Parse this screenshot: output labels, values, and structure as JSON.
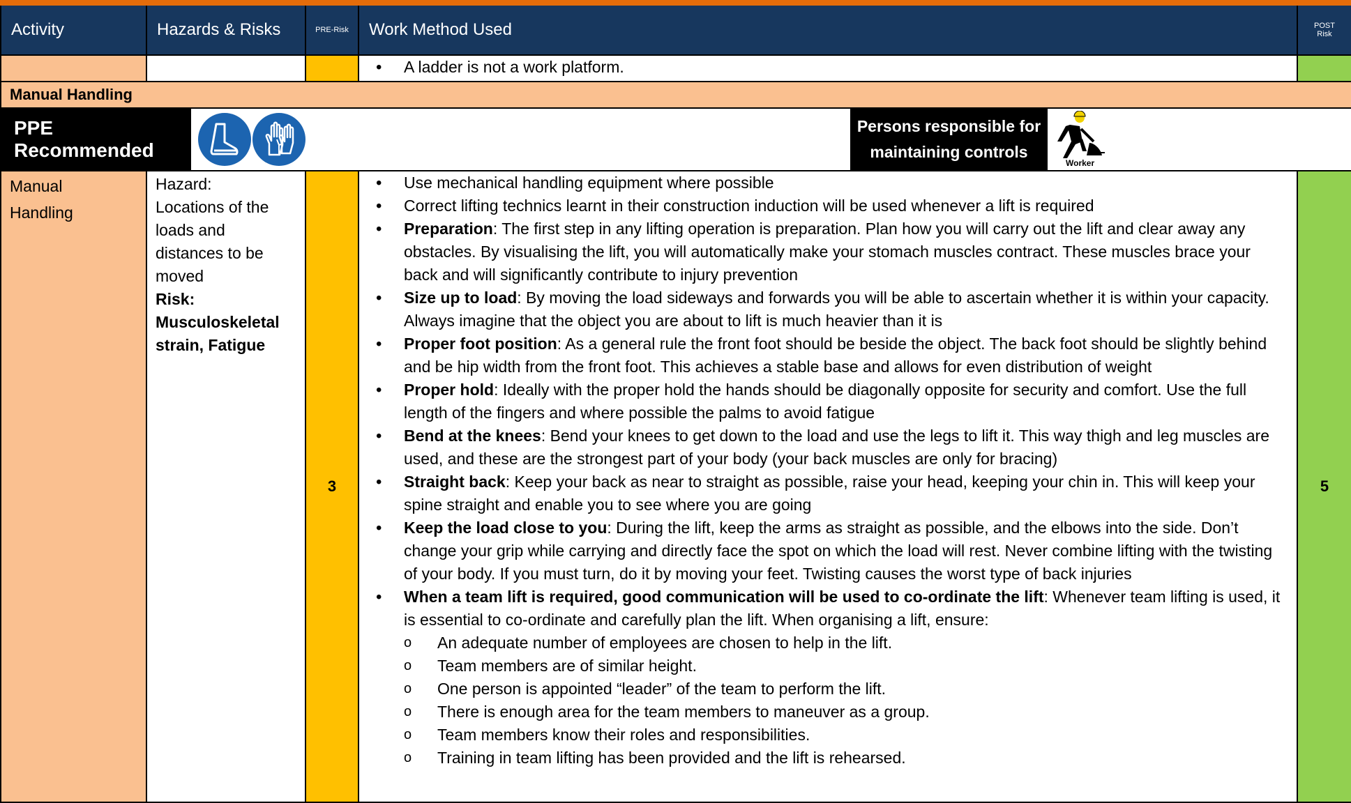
{
  "header": {
    "activity": "Activity",
    "hazards": "Hazards & Risks",
    "pre_risk": "PRE-Risk",
    "work_method": "Work Method Used",
    "post_risk_line1": "POST",
    "post_risk_line2": "Risk"
  },
  "continuation": {
    "bullet": "A ladder is not a work platform."
  },
  "section": {
    "title": "Manual Handling"
  },
  "ppe": {
    "label": "PPE Recommended",
    "icons": [
      "safety-boots-icon",
      "safety-gloves-icon"
    ],
    "persons_line1": "Persons responsible for",
    "persons_line2": "maintaining controls",
    "worker_label": "Worker",
    "icon_color": "#1c64b0"
  },
  "row": {
    "activity_line1": "Manual",
    "activity_line2": "Handling",
    "hazard_label": "Hazard:",
    "hazard_lines": [
      "Locations of the",
      "loads and",
      "distances to be",
      "moved"
    ],
    "risk_lines": [
      "Risk:",
      "Musculoskeletal",
      "strain, Fatigue"
    ],
    "pre_risk": "3",
    "post_risk": "5",
    "methods": [
      {
        "bold": "",
        "text": "Use mechanical handling equipment where possible"
      },
      {
        "bold": "",
        "text": "Correct lifting technics learnt in their construction induction will be used whenever a lift is required"
      },
      {
        "bold": "Preparation",
        "text": ":  The first step in any lifting operation is preparation. Plan how you will carry out the lift and clear away any obstacles. By visualising the lift, you will automatically make your stomach muscles contract. These muscles brace your back and will significantly contribute to injury prevention"
      },
      {
        "bold": "Size up to load",
        "text": ":  By moving the load sideways and forwards you will be able to ascertain whether it is within your capacity. Always imagine that the object you are about to lift is much heavier than it is"
      },
      {
        "bold": "Proper foot position",
        "text": ":  As a general rule the front foot should be beside the object. The back foot should be slightly behind and be hip width from the front foot. This achieves a stable base and allows for even distribution of weight"
      },
      {
        "bold": "Proper hold",
        "text": ":  Ideally with the proper hold the hands should be diagonally opposite for security and comfort. Use the full length of the fingers and where possible the palms to avoid fatigue"
      },
      {
        "bold": "Bend at the knees",
        "text": ":  Bend your knees to get down to the load and use the legs to lift it. This way thigh and leg muscles are used, and these are the strongest part of your body (your back muscles are only for bracing)"
      },
      {
        "bold": "Straight back",
        "text": ":  Keep your back as near to straight as possible, raise your head, keeping your chin in. This will keep your spine straight and enable you to see where you are going"
      },
      {
        "bold": "Keep the load close to you",
        "text": ":  During the lift, keep the arms as straight as possible, and the elbows into the side. Don’t change your grip while carrying and directly face the spot on which the load will rest. Never combine lifting with the twisting of your body. If you must turn, do it by moving your feet. Twisting causes the worst type of back injuries"
      },
      {
        "bold": "When a team lift is required, good communication will be used to co-ordinate the lift",
        "text": ":  Whenever team lifting is used, it is essential to co-ordinate and carefully plan the lift. When organising a lift, ensure:"
      }
    ],
    "sub_items": [
      "An adequate number of employees are chosen to help in the lift.",
      "Team members are of similar height.",
      "One person is appointed “leader” of the team to perform the lift.",
      "There is enough area for the team members to maneuver as a group.",
      "Team members know their roles and responsibilities.",
      "Training in team lifting has been provided and the lift is rehearsed."
    ]
  },
  "colors": {
    "header_bg": "#17375e",
    "top_bar": "#e46c0a",
    "activity_bg": "#fac090",
    "pre_risk_bg": "#ffc000",
    "post_risk_bg": "#92d050"
  }
}
